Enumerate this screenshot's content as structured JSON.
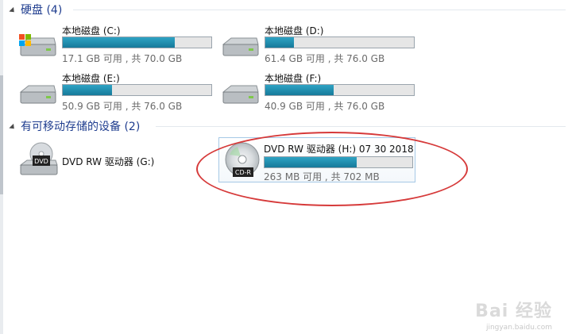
{
  "groups": {
    "hard_disks": {
      "title": "硬盘 (4)"
    },
    "removable": {
      "title": "有可移动存储的设备 (2)"
    }
  },
  "drives": [
    {
      "name": "本地磁盘 (C:)",
      "free_text": "17.1 GB 可用 , 共 70.0 GB",
      "used_fraction": 0.756,
      "icon": "windows-drive-icon"
    },
    {
      "name": "本地磁盘 (D:)",
      "free_text": "61.4 GB 可用 , 共 76.0 GB",
      "used_fraction": 0.192,
      "icon": "hard-drive-icon"
    },
    {
      "name": "本地磁盘 (E:)",
      "free_text": "50.9 GB 可用 , 共 76.0 GB",
      "used_fraction": 0.33,
      "icon": "hard-drive-icon"
    },
    {
      "name": "本地磁盘 (F:)",
      "free_text": "40.9 GB 可用 , 共 76.0 GB",
      "used_fraction": 0.462,
      "icon": "hard-drive-icon"
    }
  ],
  "removable_devices": [
    {
      "name": "DVD RW 驱动器 (G:)",
      "icon": "dvd-drive-icon",
      "badge": "DVD"
    },
    {
      "name": "DVD RW 驱动器 (H:) 07 30 2018",
      "free_text": "263 MB 可用 , 共 702 MB",
      "used_fraction": 0.625,
      "icon": "cd-r-disc-icon",
      "badge": "CD-R"
    }
  ],
  "colors": {
    "bar_fill": "#1b8db0",
    "annotation": "#d63a3a",
    "group_title": "#1f3d8f"
  },
  "watermark": {
    "text": "Bai 经验",
    "url": "jingyan.baidu.com"
  }
}
